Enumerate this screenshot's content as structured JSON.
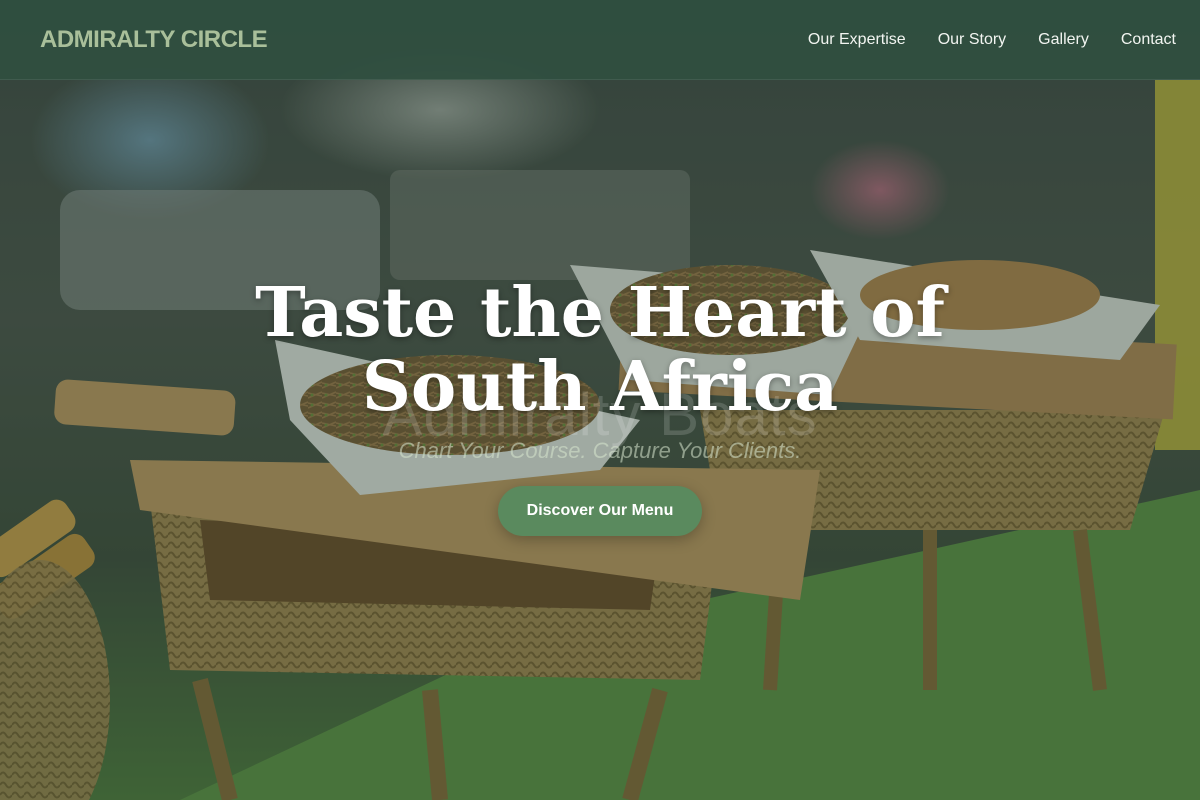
{
  "brand": {
    "name": "ADMIRALTY CIRCLE"
  },
  "nav": {
    "items": [
      {
        "label": "Our Expertise"
      },
      {
        "label": "Our Story"
      },
      {
        "label": "Gallery"
      },
      {
        "label": "Contact"
      }
    ]
  },
  "hero": {
    "title": "Taste the Heart of South Africa",
    "background_text": "Admiralty Boats",
    "tagline": "Chart Your Course. Capture Your Clients.",
    "cta_label": "Discover Our Menu",
    "background_image": "street-food-stall-photo"
  },
  "colors": {
    "nav_background": "#2f4f40",
    "brand_text": "#a9bf9a",
    "nav_text": "#f2f5f1",
    "cta_background": "#5a8a5e",
    "hero_title": "#ffffff"
  }
}
